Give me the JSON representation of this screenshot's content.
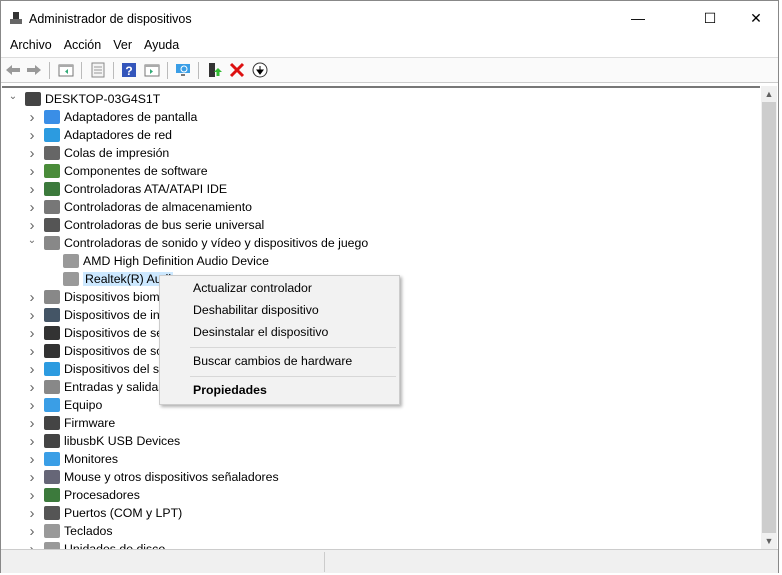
{
  "window": {
    "title": "Administrador de dispositivos",
    "minimize": "—",
    "maximize": "☐",
    "close": "✕"
  },
  "menubar": [
    "Archivo",
    "Acción",
    "Ver",
    "Ayuda"
  ],
  "toolbar": [
    "back-icon",
    "forward-icon",
    "show-hide-tree-icon",
    "properties-icon",
    "help-icon",
    "action-pane-icon",
    "scan-hardware-icon",
    "update-driver-icon",
    "uninstall-icon",
    "disable-icon"
  ],
  "tree": {
    "root": "DESKTOP-03G4S1T",
    "items": [
      {
        "label": "Adaptadores de pantalla",
        "icon": "display-adapter-icon",
        "color": "#3a8ee6"
      },
      {
        "label": "Adaptadores de red",
        "icon": "network-adapter-icon",
        "color": "#2c9be0"
      },
      {
        "label": "Colas de impresión",
        "icon": "printer-icon",
        "color": "#666"
      },
      {
        "label": "Componentes de software",
        "icon": "software-component-icon",
        "color": "#4a8c3a"
      },
      {
        "label": "Controladoras ATA/ATAPI IDE",
        "icon": "ide-controller-icon",
        "color": "#3c7a3c"
      },
      {
        "label": "Controladoras de almacenamiento",
        "icon": "storage-controller-icon",
        "color": "#777"
      },
      {
        "label": "Controladoras de bus serie universal",
        "icon": "usb-icon",
        "color": "#555"
      },
      {
        "label": "Controladoras de sonido y vídeo y dispositivos de juego",
        "icon": "speaker-icon",
        "color": "#888",
        "expanded": true,
        "children": [
          {
            "label": "AMD High Definition Audio Device",
            "icon": "speaker-icon"
          },
          {
            "label": "Realtek(R) Audi",
            "icon": "speaker-icon",
            "selected": true
          }
        ]
      },
      {
        "label": "Dispositivos biom",
        "icon": "fingerprint-icon",
        "color": "#888"
      },
      {
        "label": "Dispositivos de int",
        "icon": "hid-icon",
        "color": "#456"
      },
      {
        "label": "Dispositivos de seg",
        "icon": "security-device-icon",
        "color": "#333"
      },
      {
        "label": "Dispositivos de so",
        "icon": "software-device-icon",
        "color": "#333"
      },
      {
        "label": "Dispositivos del sis",
        "icon": "system-device-icon",
        "color": "#2c9be0"
      },
      {
        "label": "Entradas y salidas",
        "icon": "audio-io-icon",
        "color": "#888"
      },
      {
        "label": "Equipo",
        "icon": "computer-icon",
        "color": "#3a9ee6"
      },
      {
        "label": "Firmware",
        "icon": "firmware-icon",
        "color": "#444"
      },
      {
        "label": "libusbK USB Devices",
        "icon": "usb-plug-icon",
        "color": "#444"
      },
      {
        "label": "Monitores",
        "icon": "monitor-icon",
        "color": "#3a9ee6"
      },
      {
        "label": "Mouse y otros dispositivos señaladores",
        "icon": "mouse-icon",
        "color": "#667"
      },
      {
        "label": "Procesadores",
        "icon": "cpu-icon",
        "color": "#3c7a3c"
      },
      {
        "label": "Puertos (COM y LPT)",
        "icon": "port-icon",
        "color": "#555"
      },
      {
        "label": "Teclados",
        "icon": "keyboard-icon",
        "color": "#999"
      },
      {
        "label": "Unidades de disco",
        "icon": "disk-icon",
        "color": "#999"
      }
    ]
  },
  "context_menu": {
    "items": [
      "Actualizar controlador",
      "Deshabilitar dispositivo",
      "Desinstalar el dispositivo",
      "Buscar cambios de hardware",
      "Propiedades"
    ]
  }
}
